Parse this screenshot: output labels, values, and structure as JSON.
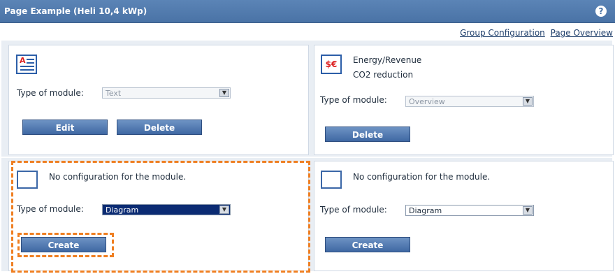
{
  "window": {
    "title": "Page Example (Heli 10,4 kWp)"
  },
  "links": {
    "group_configuration": "Group Configuration",
    "page_overview": "Page Overview"
  },
  "modules": {
    "text": {
      "type_label": "Type of module:",
      "type_value": "Text",
      "edit": "Edit",
      "delete": "Delete"
    },
    "overview": {
      "line1": "Energy/Revenue",
      "line2": "CO2 reduction",
      "type_label": "Type of module:",
      "type_value": "Overview",
      "delete": "Delete"
    },
    "diagram_left": {
      "message": "No configuration for the module.",
      "type_label": "Type of module:",
      "type_value": "Diagram",
      "create": "Create"
    },
    "diagram_right": {
      "message": "No configuration for the module.",
      "type_label": "Type of module:",
      "type_value": "Diagram",
      "create": "Create"
    }
  },
  "icons": {
    "text_module": "text-document-icon",
    "money_module": "currency-icon",
    "help": "help-icon",
    "empty_module": "empty-module-icon"
  },
  "colors": {
    "titlebar": "#4a73a6",
    "highlight": "#ef7f22"
  }
}
